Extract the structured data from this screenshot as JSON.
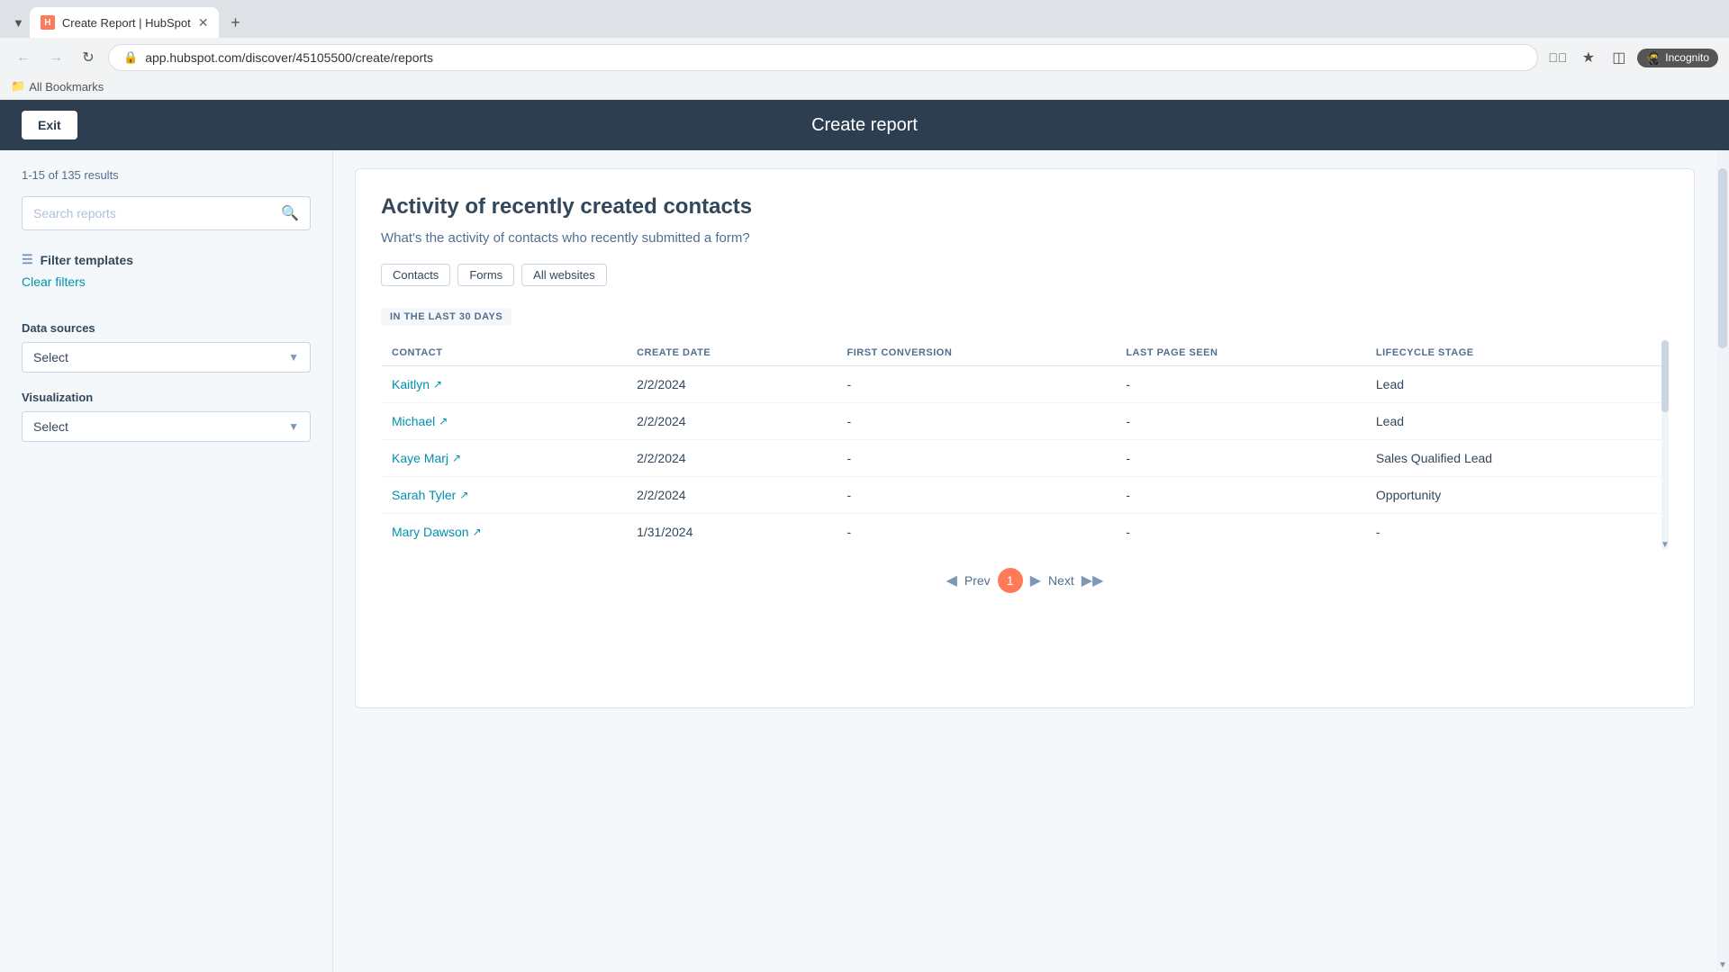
{
  "browser": {
    "tab_label": "Create Report | HubSpot",
    "tab_new": "+",
    "url": "app.hubspot.com/discover/45105500/create/reports",
    "incognito_label": "Incognito",
    "bookmarks_label": "All Bookmarks"
  },
  "header": {
    "exit_label": "Exit",
    "title": "Create report"
  },
  "sidebar": {
    "results_count": "1-15 of 135 results",
    "search_placeholder": "Search reports",
    "filter_templates_label": "Filter templates",
    "clear_filters_label": "Clear filters",
    "data_sources_label": "Data sources",
    "data_sources_placeholder": "Select",
    "visualization_label": "Visualization",
    "visualization_placeholder": "Select"
  },
  "report": {
    "title": "Activity of recently created contacts",
    "description": "What's the activity of contacts who recently submitted a form?",
    "tags": [
      "Contacts",
      "Forms",
      "All websites"
    ],
    "period_label": "IN THE LAST 30 DAYS",
    "table": {
      "columns": [
        "CONTACT",
        "CREATE DATE",
        "FIRST CONVERSION",
        "LAST PAGE SEEN",
        "LIFECYCLE STAGE"
      ],
      "rows": [
        {
          "contact": "Kaitlyn",
          "create_date": "2/2/2024",
          "first_conversion": "-",
          "last_page_seen": "-",
          "lifecycle_stage": "Lead"
        },
        {
          "contact": "Michael",
          "create_date": "2/2/2024",
          "first_conversion": "-",
          "last_page_seen": "-",
          "lifecycle_stage": "Lead"
        },
        {
          "contact": "Kaye Marj",
          "create_date": "2/2/2024",
          "first_conversion": "-",
          "last_page_seen": "-",
          "lifecycle_stage": "Sales Qualified Lead"
        },
        {
          "contact": "Sarah Tyler",
          "create_date": "2/2/2024",
          "first_conversion": "-",
          "last_page_seen": "-",
          "lifecycle_stage": "Opportunity"
        },
        {
          "contact": "Mary Dawson",
          "create_date": "1/31/2024",
          "first_conversion": "-",
          "last_page_seen": "-",
          "lifecycle_stage": "-"
        }
      ]
    },
    "pagination": {
      "prev_label": "Prev",
      "next_label": "Next",
      "current_page": "1"
    }
  }
}
